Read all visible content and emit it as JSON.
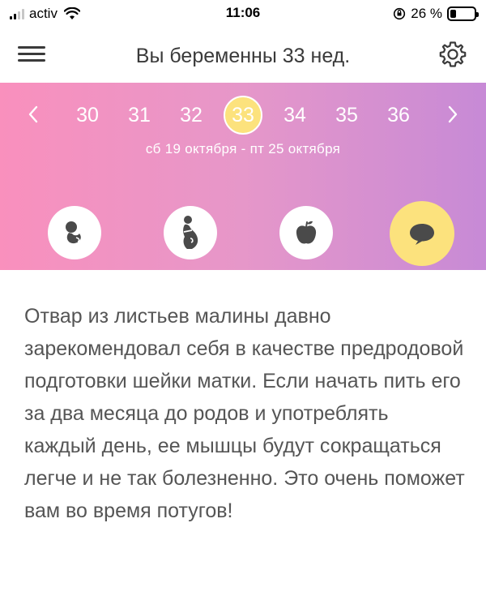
{
  "status_bar": {
    "carrier": "activ",
    "time": "11:06",
    "battery_percent": "26 %",
    "battery_level": 0.26,
    "icons": [
      "signal-icon",
      "wifi-icon",
      "orientation-lock-icon",
      "battery-icon"
    ]
  },
  "header": {
    "title": "Вы беременны 33 нед.",
    "menu_icon": "hamburger-menu-icon",
    "settings_icon": "gear-icon"
  },
  "week_selector": {
    "weeks": [
      "30",
      "31",
      "32",
      "33",
      "34",
      "35",
      "36"
    ],
    "active_week": "33",
    "date_range": "сб 19 октября - пт 25 октября"
  },
  "category_icons": [
    "baby-icon",
    "pregnant-icon",
    "apple-icon",
    "chat-bubble-icon"
  ],
  "active_category": "chat-bubble-icon",
  "content": {
    "text": "Отвар из листьев малины давно зарекомендовал себя в качестве предродовой подготовки шейки матки. Если начать пить его за два месяца до родов и употреблять каждый день, ее мышцы будут сокращаться легче и не так болезненно. Это очень поможет вам во время потугов!"
  },
  "colors": {
    "gradient_start": "#f990bd",
    "gradient_end": "#c78ad6",
    "accent_yellow": "#fce27d",
    "text": "#555555"
  }
}
